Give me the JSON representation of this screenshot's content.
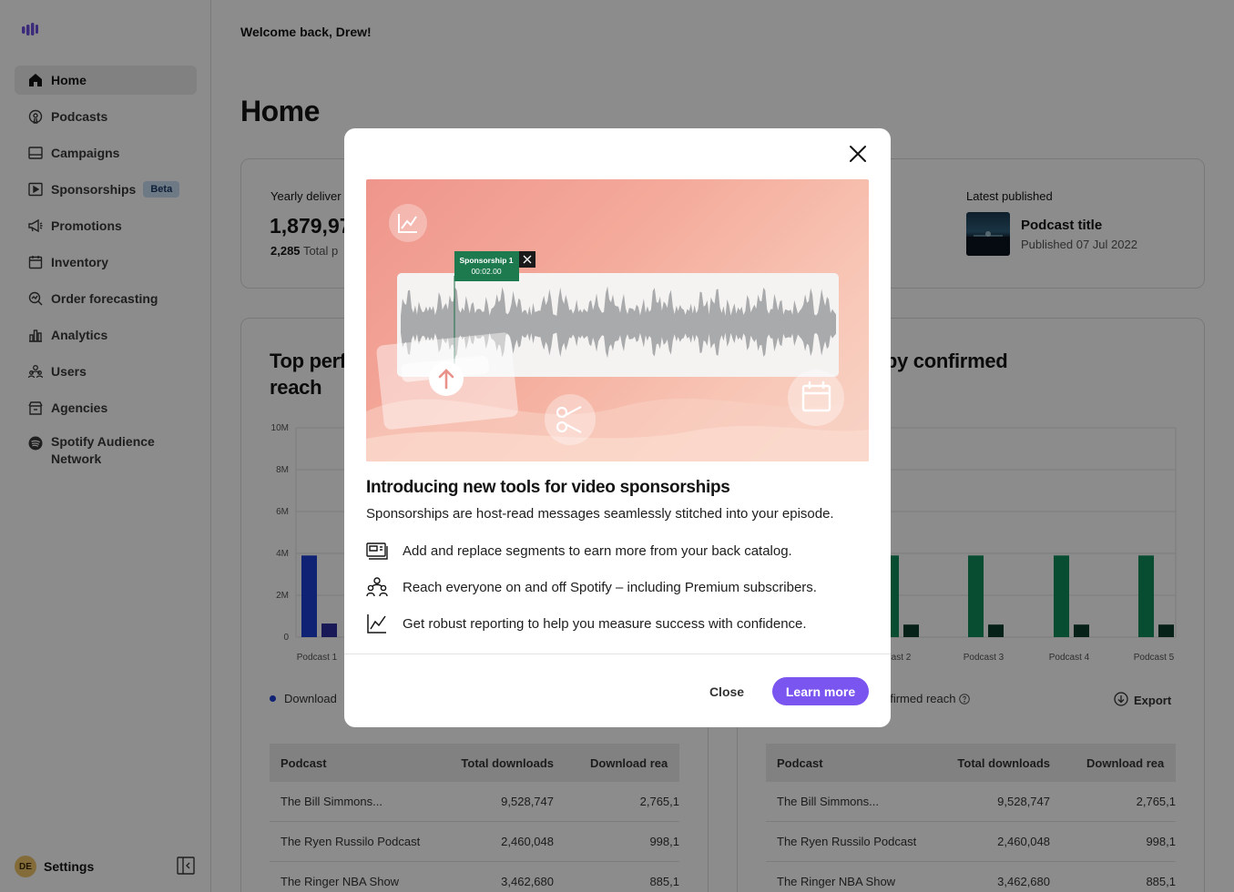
{
  "sidebar": {
    "items": [
      {
        "label": "Home",
        "icon": "home-icon"
      },
      {
        "label": "Podcasts",
        "icon": "podcast-icon"
      },
      {
        "label": "Campaigns",
        "icon": "campaign-icon"
      },
      {
        "label": "Sponsorships",
        "icon": "play-square-icon",
        "badge": "Beta"
      },
      {
        "label": "Promotions",
        "icon": "megaphone-icon"
      },
      {
        "label": "Inventory",
        "icon": "calendar-icon"
      },
      {
        "label": "Order forecasting",
        "icon": "forecast-icon"
      },
      {
        "label": "Analytics",
        "icon": "bar-chart-icon"
      },
      {
        "label": "Users",
        "icon": "users-icon"
      },
      {
        "label": "Agencies",
        "icon": "building-icon"
      },
      {
        "label": "Spotify Audience Network",
        "icon": "spotify-icon"
      }
    ],
    "settings": {
      "avatar_initials": "DE",
      "label": "Settings"
    }
  },
  "header": {
    "welcome": "Welcome back, Drew!",
    "title": "Home"
  },
  "stats": {
    "yearly_label": "Yearly deliver",
    "yearly_value": "1,879,97",
    "total_value": "2,285",
    "total_label": "Total p",
    "latest_label": "Latest published",
    "latest_title": "Podcast title",
    "latest_date": "Published 07 Jul 2022"
  },
  "left_card": {
    "title_line1": "Top perf",
    "title_line2": "reach",
    "legend": "Download",
    "table": {
      "headers": [
        "Podcast",
        "Total downloads",
        "Download rea"
      ],
      "rows": [
        [
          "The Bill Simmons...",
          "9,528,747",
          "2,765,1"
        ],
        [
          "The Ryen Russilo Podcast",
          "2,460,048",
          "998,1"
        ],
        [
          "The Ringer NBA Show",
          "3,462,680",
          "885,1"
        ]
      ]
    }
  },
  "right_card": {
    "title_line1": "ng episodes by confirmed",
    "legend": "nfirmed reach",
    "export": "Export",
    "table": {
      "headers": [
        "Podcast",
        "Total downloads",
        "Download rea"
      ],
      "rows": [
        [
          "The Bill Simmons...",
          "9,528,747",
          "2,765,1"
        ],
        [
          "The Ryen Russilo Podcast",
          "2,460,048",
          "998,1"
        ],
        [
          "The Ringer NBA Show",
          "3,462,680",
          "885,1"
        ]
      ]
    }
  },
  "chart_data": [
    {
      "type": "bar",
      "categories": [
        "Podcast 1"
      ],
      "y_ticks": [
        "10M",
        "8M",
        "6M",
        "4M",
        "2M",
        "0"
      ],
      "ylim": [
        0,
        10000000
      ],
      "series": [
        {
          "name": "Download",
          "color": "#1e3ed1",
          "values": [
            3900000
          ]
        },
        {
          "color": "#2e2f9e",
          "values": [
            650000
          ]
        }
      ]
    },
    {
      "type": "bar",
      "categories": [
        "cast 2",
        "Podcast 3",
        "Podcast 4",
        "Podcast 5"
      ],
      "ylim": [
        0,
        10000000
      ],
      "series": [
        {
          "color": "#0f8a5c",
          "values": [
            3900000,
            3900000,
            3900000,
            3900000
          ]
        },
        {
          "name": "nfirmed reach",
          "color": "#0c3d2b",
          "values": [
            600000,
            600000,
            600000,
            600000
          ]
        }
      ]
    }
  ],
  "modal": {
    "hero": {
      "tag_title": "Sponsorship 1",
      "tag_time": "00:02.00"
    },
    "heading": "Introducing new tools for video sponsorships",
    "intro": "Sponsorships are host-read messages seamlessly stitched into your episode.",
    "features": [
      {
        "icon": "segments-icon",
        "text": "Add and replace segments to earn more from your back catalog."
      },
      {
        "icon": "audience-icon",
        "text": "Reach everyone on and off Spotify – including Premium subscribers."
      },
      {
        "icon": "line-chart-icon",
        "text": "Get robust reporting to help you measure success with confidence."
      }
    ],
    "close_label": "Close",
    "learn_more_label": "Learn more"
  }
}
